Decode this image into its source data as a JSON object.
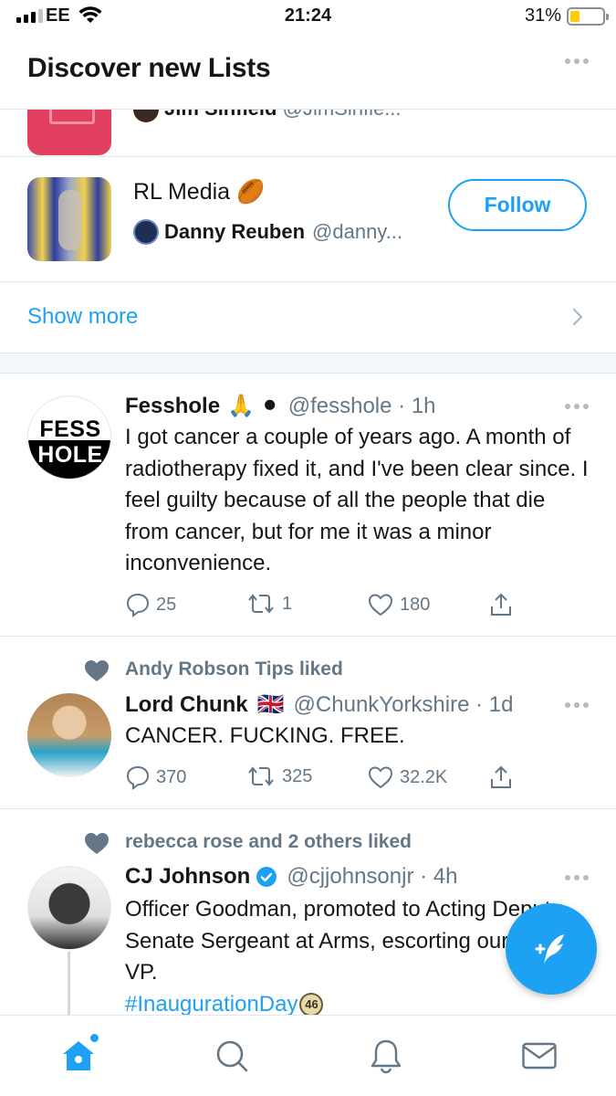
{
  "status_bar": {
    "carrier": "EE",
    "time": "21:24",
    "battery_pct": "31%"
  },
  "header": {
    "title": "Discover new Lists"
  },
  "partial_list": {
    "owner_name": "Jim Sinfield",
    "owner_handle": "@JimSinfie..."
  },
  "list_card": {
    "name": "RL Media",
    "name_emoji": "🏉",
    "owner_name": "Danny Reuben",
    "owner_handle": "@danny...",
    "follow_label": "Follow"
  },
  "show_more": {
    "label": "Show more"
  },
  "tweets": [
    {
      "display_name": "Fesshole",
      "badges": "🙏 ⚫",
      "handle": "@fesshole",
      "time": "1h",
      "text": "I got cancer a couple of years ago. A month of radiotherapy fixed it, and I've been clear since. I feel guilty because of all the people that die from cancer, but for me it was a minor inconvenience.",
      "replies": "25",
      "retweets": "1",
      "likes": "180",
      "avatar_top": "FESS",
      "avatar_bottom": "HOLE"
    },
    {
      "social_context": "Andy Robson Tips liked",
      "display_name": "Lord Chunk",
      "flag": "🇬🇧",
      "handle": "@ChunkYorkshire",
      "time": "1d",
      "text": "CANCER. FUCKING. FREE.",
      "replies": "370",
      "retweets": "325",
      "likes": "32.2K"
    },
    {
      "social_context": "rebecca rose and 2 others liked",
      "display_name": "CJ Johnson",
      "handle": "@cjjohnsonjr",
      "time": "4h",
      "text": "Officer Goodman, promoted to Acting Deputy Senate Sergeant at Arms, escorting our new VP.",
      "hashtag": "#InaugurationDay",
      "hashtag_badge": "46"
    }
  ],
  "tab_bar": {
    "tabs": [
      {
        "name": "home",
        "icon": "home-icon"
      },
      {
        "name": "search",
        "icon": "search-icon"
      },
      {
        "name": "notifications",
        "icon": "bell-icon"
      },
      {
        "name": "messages",
        "icon": "mail-icon"
      }
    ]
  },
  "colors": {
    "accent": "#1da1f2",
    "secondary_text": "#657786",
    "divider": "#e1e8ed"
  }
}
